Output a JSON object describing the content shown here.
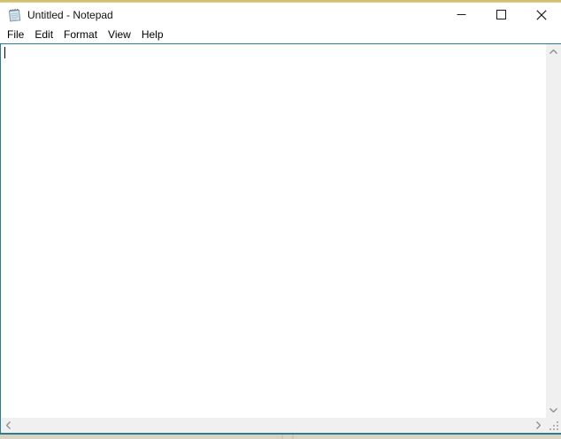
{
  "window": {
    "title": "Untitled - Notepad",
    "app_icon": "notepad-icon",
    "controls": [
      {
        "name": "minimize",
        "icon": "minimize-icon"
      },
      {
        "name": "maximize",
        "icon": "maximize-icon"
      },
      {
        "name": "close",
        "icon": "close-icon"
      }
    ]
  },
  "menu": {
    "items": [
      {
        "label": "File"
      },
      {
        "label": "Edit"
      },
      {
        "label": "Format"
      },
      {
        "label": "View"
      },
      {
        "label": "Help"
      }
    ]
  },
  "editor": {
    "content": "",
    "caret_visible": true
  },
  "scrollbars": {
    "vertical": {
      "up_icon": "chevron-up-icon",
      "down_icon": "chevron-down-icon"
    },
    "horizontal": {
      "left_icon": "chevron-left-icon",
      "right_icon": "chevron-right-icon"
    },
    "corner_icon": "resize-grip-icon"
  },
  "colors": {
    "accent_border": "#2c7d91",
    "top_border": "#d8c777",
    "titlebar_bg": "#ffffff",
    "scrollbar_track": "#f0f0f0",
    "scrollbar_arrow": "#8c8c8c",
    "desktop_strip": "#d9d3c2",
    "text": "#000000"
  }
}
